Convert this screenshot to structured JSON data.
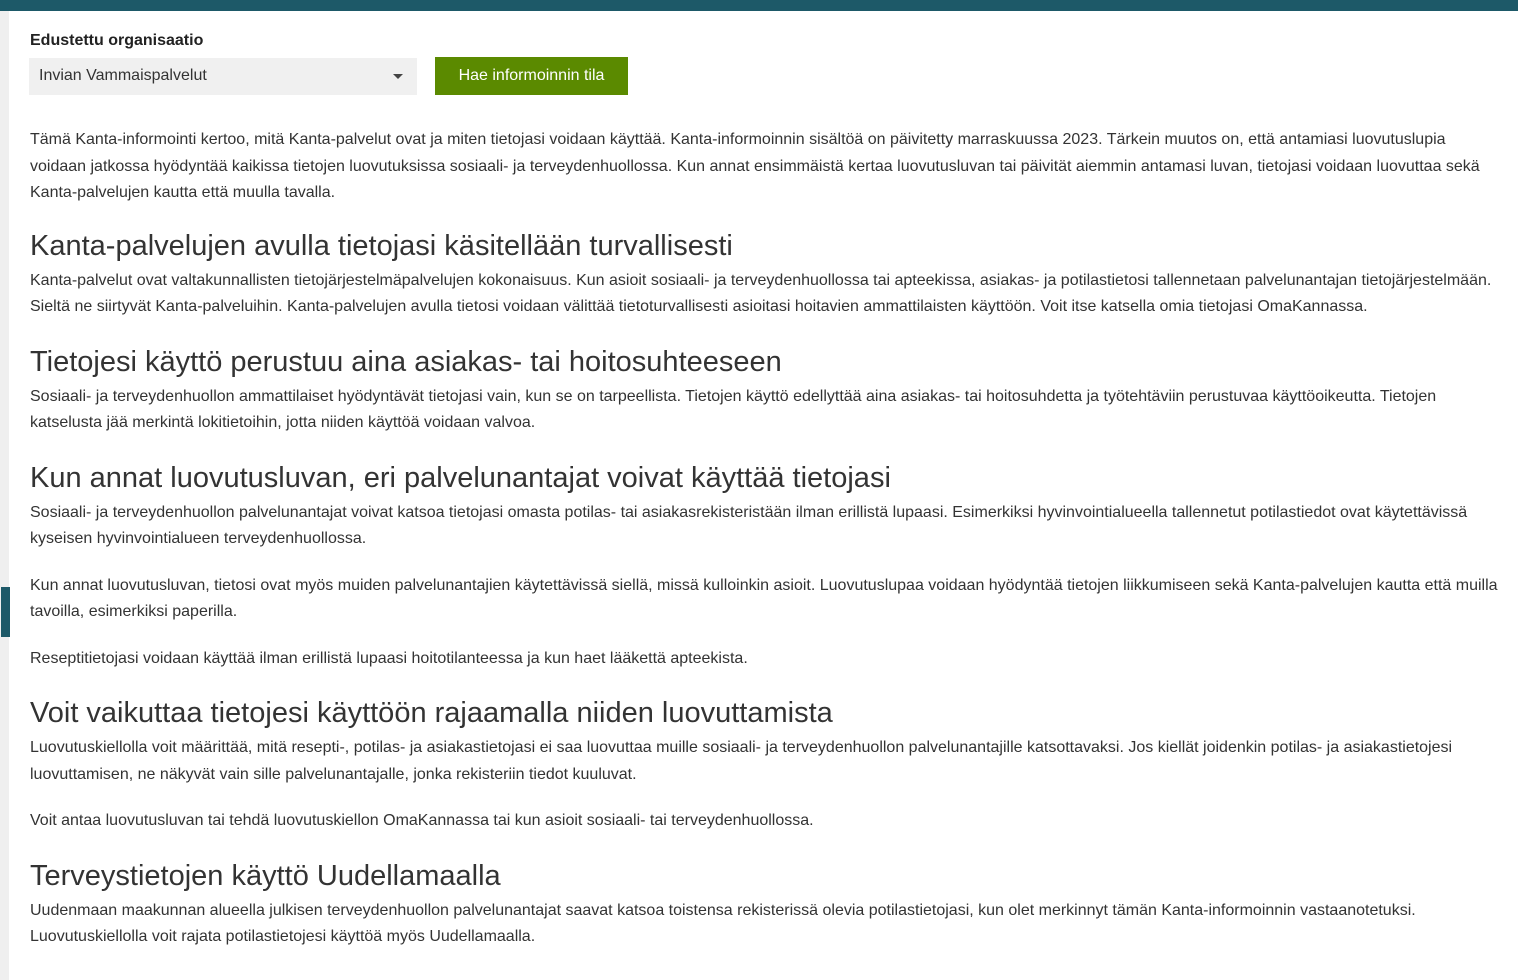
{
  "organization": {
    "label": "Edustettu organisaatio",
    "selected": "Invian Vammaispalvelut",
    "fetch_button": "Hae informoinnin tila"
  },
  "intro": "Tämä Kanta-informointi kertoo, mitä Kanta-palvelut ovat ja miten tietojasi voidaan käyttää. Kanta-informoinnin sisältöä on päivitetty marraskuussa 2023. Tärkein muutos on, että antamiasi luovutuslupia voidaan jatkossa hyödyntää kaikissa tietojen luovutuksissa sosiaali- ja terveydenhuollossa. Kun annat ensimmäistä kertaa luovutusluvan tai päivität aiemmin antamasi luvan, tietojasi voidaan luovuttaa sekä Kanta-palvelujen kautta että muulla tavalla.",
  "sections": [
    {
      "heading": "Kanta-palvelujen avulla tietojasi käsitellään turvallisesti",
      "paragraphs": [
        "Kanta-palvelut ovat valtakunnallisten tietojärjestelmäpalvelujen kokonaisuus. Kun asioit sosiaali- ja terveydenhuollossa tai apteekissa, asiakas- ja potilastietosi tallennetaan palvelunantajan tietojärjestelmään. Sieltä ne siirtyvät Kanta-palveluihin. Kanta-palvelujen avulla tietosi voidaan välittää tietoturvallisesti asioitasi hoitavien ammattilaisten käyttöön. Voit itse katsella omia tietojasi OmaKannassa."
      ]
    },
    {
      "heading": "Tietojesi käyttö perustuu aina asiakas- tai hoitosuhteeseen",
      "paragraphs": [
        "Sosiaali- ja terveydenhuollon ammattilaiset hyödyntävät tietojasi vain, kun se on tarpeellista. Tietojen käyttö edellyttää aina asiakas- tai hoitosuhdetta ja työtehtäviin perustuvaa käyttöoikeutta. Tietojen katselusta jää merkintä lokitietoihin, jotta niiden käyttöä voidaan valvoa."
      ]
    },
    {
      "heading": "Kun annat luovutusluvan, eri palvelunantajat voivat käyttää tietojasi",
      "paragraphs": [
        "Sosiaali- ja terveydenhuollon palvelunantajat voivat katsoa tietojasi omasta potilas- tai asiakasrekisteristään ilman erillistä lupaasi. Esimerkiksi hyvinvointialueella tallennetut potilastiedot ovat käytettävissä kyseisen hyvinvointialueen terveydenhuollossa.",
        "Kun annat luovutusluvan, tietosi ovat myös muiden palvelunantajien käytettävissä siellä, missä kulloinkin asioit. Luovutuslupaa voidaan hyödyntää tietojen liikkumiseen sekä Kanta-palvelujen kautta että muilla tavoilla, esimerkiksi paperilla.",
        "Reseptitietojasi voidaan käyttää ilman erillistä lupaasi hoitotilanteessa ja kun haet lääkettä apteekista."
      ]
    },
    {
      "heading": "Voit vaikuttaa tietojesi käyttöön rajaamalla niiden luovuttamista",
      "paragraphs": [
        "Luovutuskiellolla voit määrittää, mitä resepti-, potilas- ja asiakastietojasi ei saa luovuttaa muille sosiaali- ja terveydenhuollon palvelunantajille katsottavaksi. Jos kiellät joidenkin potilas- ja asiakastietojesi luovuttamisen, ne näkyvät vain sille palvelunantajalle, jonka rekisteriin tiedot kuuluvat.",
        "Voit antaa luovutusluvan tai tehdä luovutuskiellon OmaKannassa tai kun asioit sosiaali- tai terveydenhuollossa."
      ]
    },
    {
      "heading": "Terveystietojen käyttö Uudellamaalla",
      "paragraphs": [
        "Uudenmaan maakunnan alueella julkisen terveydenhuollon palvelunantajat saavat katsoa toistensa rekisterissä olevia potilastietojasi, kun olet merkinnyt tämän Kanta-informoinnin vastaanotetuksi. Luovutuskiellolla voit rajata potilastietojesi käyttöä myös Uudellamaalla."
      ]
    }
  ]
}
